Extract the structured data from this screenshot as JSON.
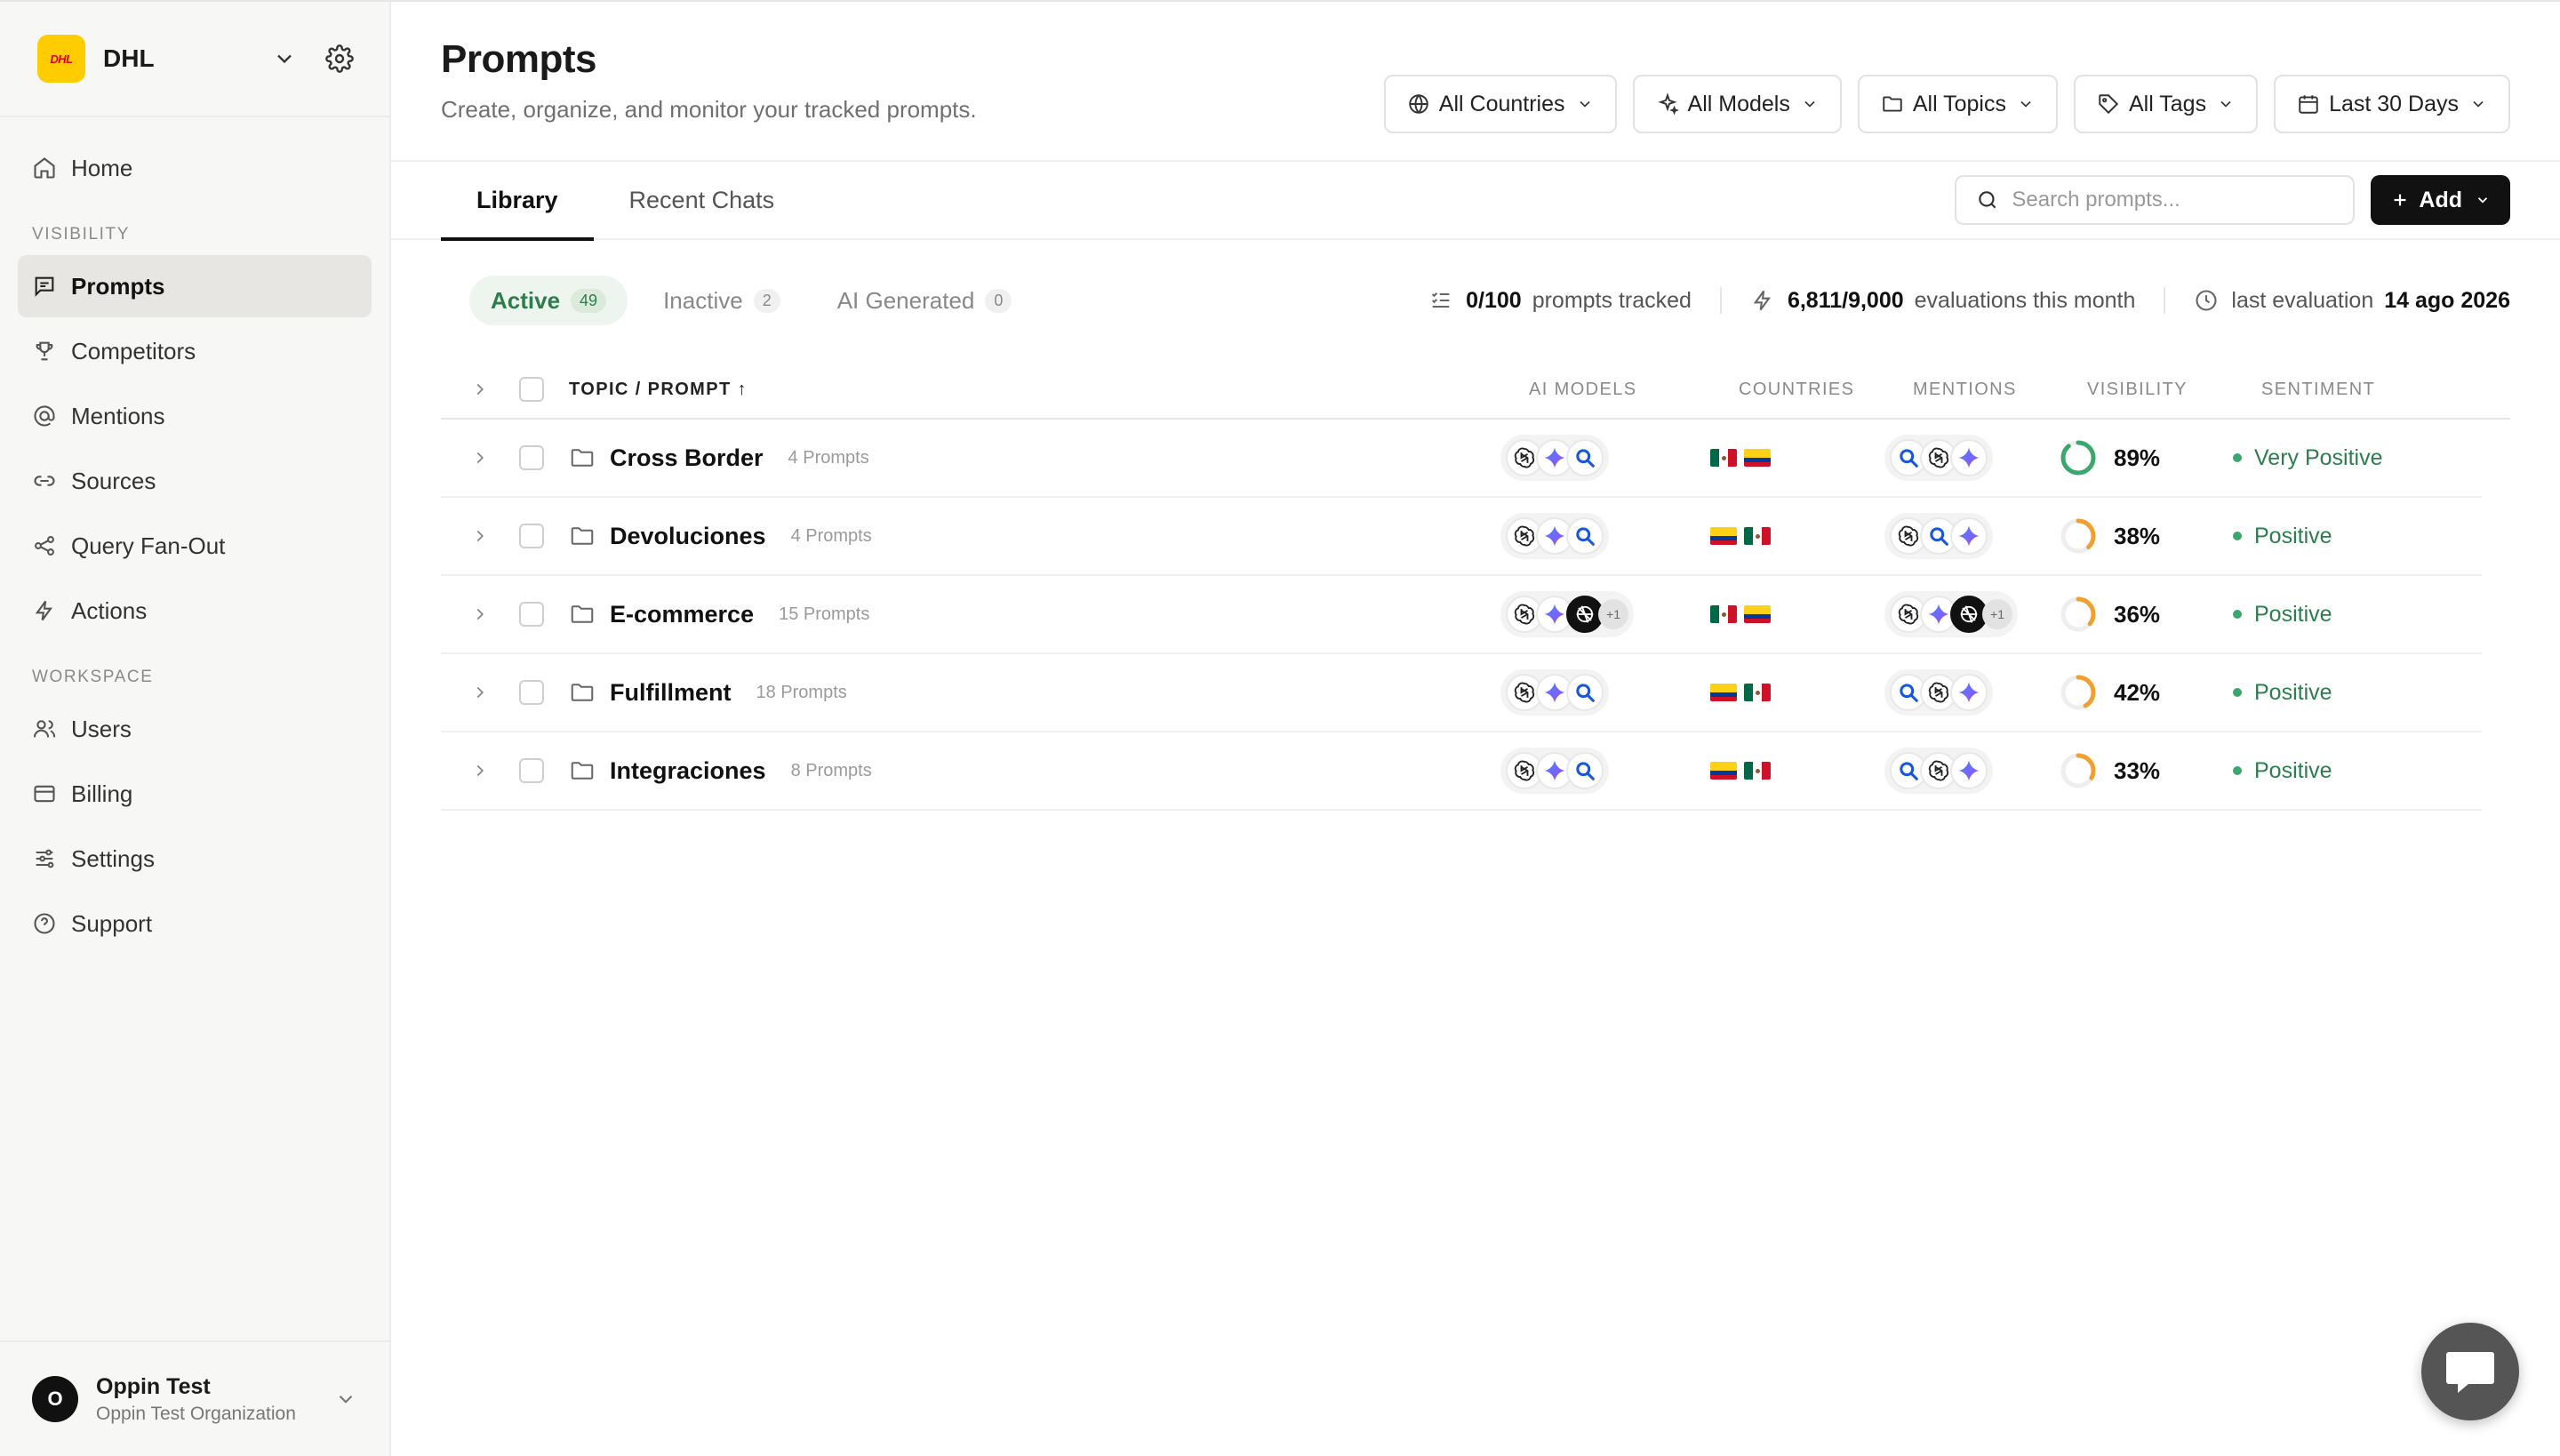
{
  "brand": {
    "name": "DHL",
    "logo_text": "DHL"
  },
  "nav": {
    "items_top": [
      {
        "label": "Home",
        "icon": "home-icon"
      },
      {
        "section": "VISIBILITY"
      },
      {
        "label": "Prompts",
        "icon": "chat-icon",
        "active": true
      },
      {
        "label": "Competitors",
        "icon": "trophy-icon"
      },
      {
        "label": "Mentions",
        "icon": "at-icon"
      },
      {
        "label": "Sources",
        "icon": "link-icon"
      },
      {
        "label": "Query Fan-Out",
        "icon": "share-icon"
      },
      {
        "label": "Actions",
        "icon": "bolt-icon"
      },
      {
        "section": "WORKSPACE"
      },
      {
        "label": "Users",
        "icon": "users-icon"
      },
      {
        "label": "Billing",
        "icon": "card-icon"
      },
      {
        "label": "Settings",
        "icon": "sliders-icon"
      },
      {
        "label": "Support",
        "icon": "help-icon"
      }
    ],
    "labels": {
      "home": "Home",
      "visibility": "VISIBILITY",
      "prompts": "Prompts",
      "competitors": "Competitors",
      "mentions": "Mentions",
      "sources": "Sources",
      "fanout": "Query Fan-Out",
      "actions": "Actions",
      "workspace": "WORKSPACE",
      "users": "Users",
      "billing": "Billing",
      "settings": "Settings",
      "support": "Support"
    }
  },
  "user": {
    "initial": "O",
    "name": "Oppin Test",
    "org": "Oppin Test Organization"
  },
  "header": {
    "title": "Prompts",
    "subtitle": "Create, organize, and monitor your tracked prompts.",
    "filters": {
      "countries": "All Countries",
      "models": "All Models",
      "topics": "All Topics",
      "tags": "All Tags",
      "date": "Last 30 Days"
    }
  },
  "tabs": {
    "library": "Library",
    "recent": "Recent Chats"
  },
  "search": {
    "placeholder": "Search prompts..."
  },
  "add_button": "Add",
  "status_tabs": {
    "active": {
      "label": "Active",
      "count": "49"
    },
    "inactive": {
      "label": "Inactive",
      "count": "2"
    },
    "ai": {
      "label": "AI Generated",
      "count": "0"
    }
  },
  "stats": {
    "tracked_value": "0/100",
    "tracked_label": "prompts tracked",
    "evals_value": "6,811/9,000",
    "evals_label": "evaluations this month",
    "last_label": "last evaluation",
    "last_value": "14 ago 2026"
  },
  "columns": {
    "topic": "TOPIC / PROMPT ↑",
    "models": "AI MODELS",
    "countries": "COUNTRIES",
    "mentions": "MENTIONS",
    "visibility": "VISIBILITY",
    "sentiment": "SENTIMENT"
  },
  "rows": [
    {
      "name": "Cross Border",
      "count": "4 Prompts",
      "models": [
        "openai",
        "gemini",
        "search"
      ],
      "models_extra": "",
      "countries": [
        "mx",
        "co"
      ],
      "mentions": [
        "search",
        "openai",
        "gemini"
      ],
      "mentions_extra": "",
      "visibility": "89%",
      "visibility_value": 0.89,
      "ring_color": "#3aa76d",
      "sentiment": "Very Positive"
    },
    {
      "name": "Devoluciones",
      "count": "4 Prompts",
      "models": [
        "openai",
        "gemini",
        "search"
      ],
      "models_extra": "",
      "countries": [
        "co",
        "mx"
      ],
      "mentions": [
        "openai",
        "search",
        "gemini"
      ],
      "mentions_extra": "",
      "visibility": "38%",
      "visibility_value": 0.38,
      "ring_color": "#f0a030",
      "sentiment": "Positive"
    },
    {
      "name": "E-commerce",
      "count": "15 Prompts",
      "models": [
        "openai",
        "gemini",
        "grok"
      ],
      "models_extra": "+1",
      "countries": [
        "mx",
        "co"
      ],
      "mentions": [
        "openai",
        "gemini",
        "grok"
      ],
      "mentions_extra": "+1",
      "visibility": "36%",
      "visibility_value": 0.36,
      "ring_color": "#f0a030",
      "sentiment": "Positive"
    },
    {
      "name": "Fulfillment",
      "count": "18 Prompts",
      "models": [
        "openai",
        "gemini",
        "search"
      ],
      "models_extra": "",
      "countries": [
        "co",
        "mx"
      ],
      "mentions": [
        "search",
        "openai",
        "gemini"
      ],
      "mentions_extra": "",
      "visibility": "42%",
      "visibility_value": 0.42,
      "ring_color": "#f0a030",
      "sentiment": "Positive"
    },
    {
      "name": "Integraciones",
      "count": "8 Prompts",
      "models": [
        "openai",
        "gemini",
        "search"
      ],
      "models_extra": "",
      "countries": [
        "co",
        "mx"
      ],
      "mentions": [
        "search",
        "openai",
        "gemini"
      ],
      "mentions_extra": "",
      "visibility": "33%",
      "visibility_value": 0.33,
      "ring_color": "#f0a030",
      "sentiment": "Positive"
    }
  ],
  "colors": {
    "accent": "#111111",
    "positive": "#2e7d4f",
    "positive_dot": "#3aa76d",
    "warning": "#f0a030"
  }
}
